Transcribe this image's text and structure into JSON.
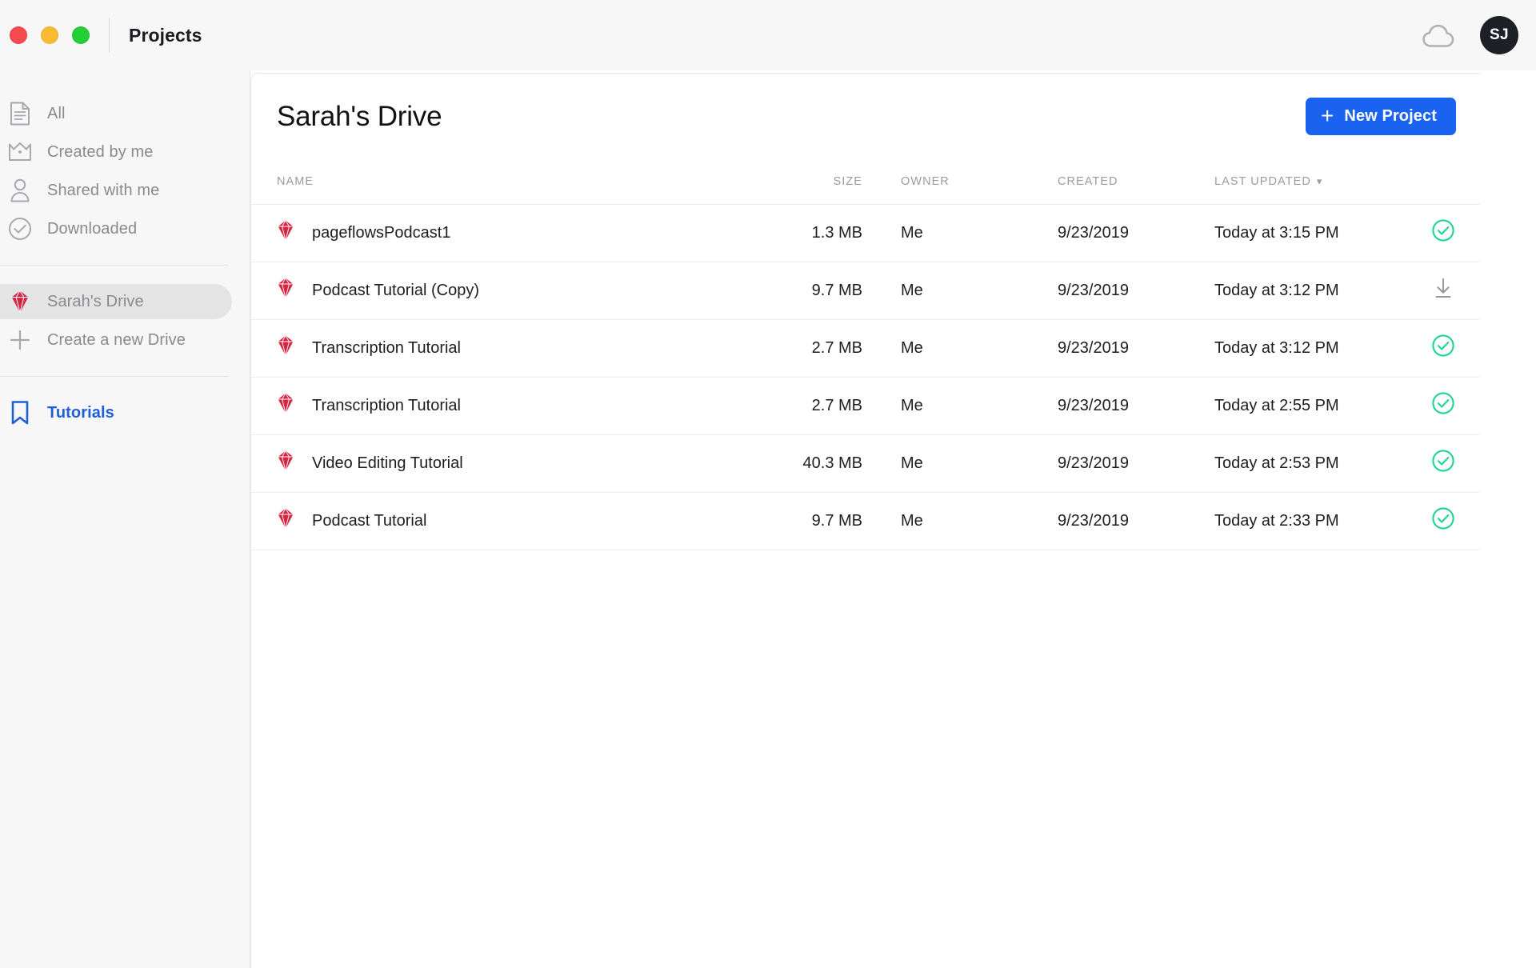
{
  "window": {
    "title": "Projects",
    "traffic_lights": [
      "close-red",
      "minimize-yellow",
      "maximize-green"
    ],
    "cloud_icon": "cloud-icon",
    "avatar_initials": "SJ"
  },
  "sidebar": {
    "filters": [
      {
        "label": "All",
        "icon": "document-icon",
        "active": false
      },
      {
        "label": "Created by me",
        "icon": "crown-icon",
        "active": false
      },
      {
        "label": "Shared with me",
        "icon": "person-icon",
        "active": false
      },
      {
        "label": "Downloaded",
        "icon": "check-circle-icon",
        "active": false
      }
    ],
    "drives": [
      {
        "label": "Sarah's Drive",
        "icon": "gem-icon",
        "active": true
      },
      {
        "label": "Create a new Drive",
        "icon": "plus-icon",
        "active": false
      }
    ],
    "links": [
      {
        "label": "Tutorials",
        "icon": "bookmark-icon",
        "accent": true
      }
    ]
  },
  "main": {
    "title": "Sarah's Drive",
    "new_project_label": "New Project",
    "new_project_icon": "plus-icon",
    "columns": {
      "name": "NAME",
      "size": "SIZE",
      "owner": "OWNER",
      "created": "CREATED",
      "last_updated": "LAST UPDATED",
      "sort_icon": "chevron-down-icon"
    },
    "rows": [
      {
        "icon": "gem-icon",
        "name": "pageflowsPodcast1",
        "size": "1.3 MB",
        "owner": "Me",
        "created": "9/23/2019",
        "updated": "Today at 3:15 PM",
        "status": "synced"
      },
      {
        "icon": "gem-icon",
        "name": "Podcast Tutorial (Copy)",
        "size": "9.7 MB",
        "owner": "Me",
        "created": "9/23/2019",
        "updated": "Today at 3:12 PM",
        "status": "download"
      },
      {
        "icon": "gem-icon",
        "name": "Transcription Tutorial",
        "size": "2.7 MB",
        "owner": "Me",
        "created": "9/23/2019",
        "updated": "Today at 3:12 PM",
        "status": "synced"
      },
      {
        "icon": "gem-icon",
        "name": "Transcription Tutorial",
        "size": "2.7 MB",
        "owner": "Me",
        "created": "9/23/2019",
        "updated": "Today at 2:55 PM",
        "status": "synced"
      },
      {
        "icon": "gem-icon",
        "name": "Video Editing Tutorial",
        "size": "40.3 MB",
        "owner": "Me",
        "created": "9/23/2019",
        "updated": "Today at 2:53 PM",
        "status": "synced"
      },
      {
        "icon": "gem-icon",
        "name": "Podcast Tutorial",
        "size": "9.7 MB",
        "owner": "Me",
        "created": "9/23/2019",
        "updated": "Today at 2:33 PM",
        "status": "synced"
      }
    ]
  },
  "colors": {
    "accent_blue": "#1a62f0",
    "link_blue": "#1e5fd8",
    "status_green": "#1ed497",
    "gem_red": "#cf2744",
    "sidebar_bg": "#f7f7f7",
    "muted_text": "#8a8a8e"
  }
}
